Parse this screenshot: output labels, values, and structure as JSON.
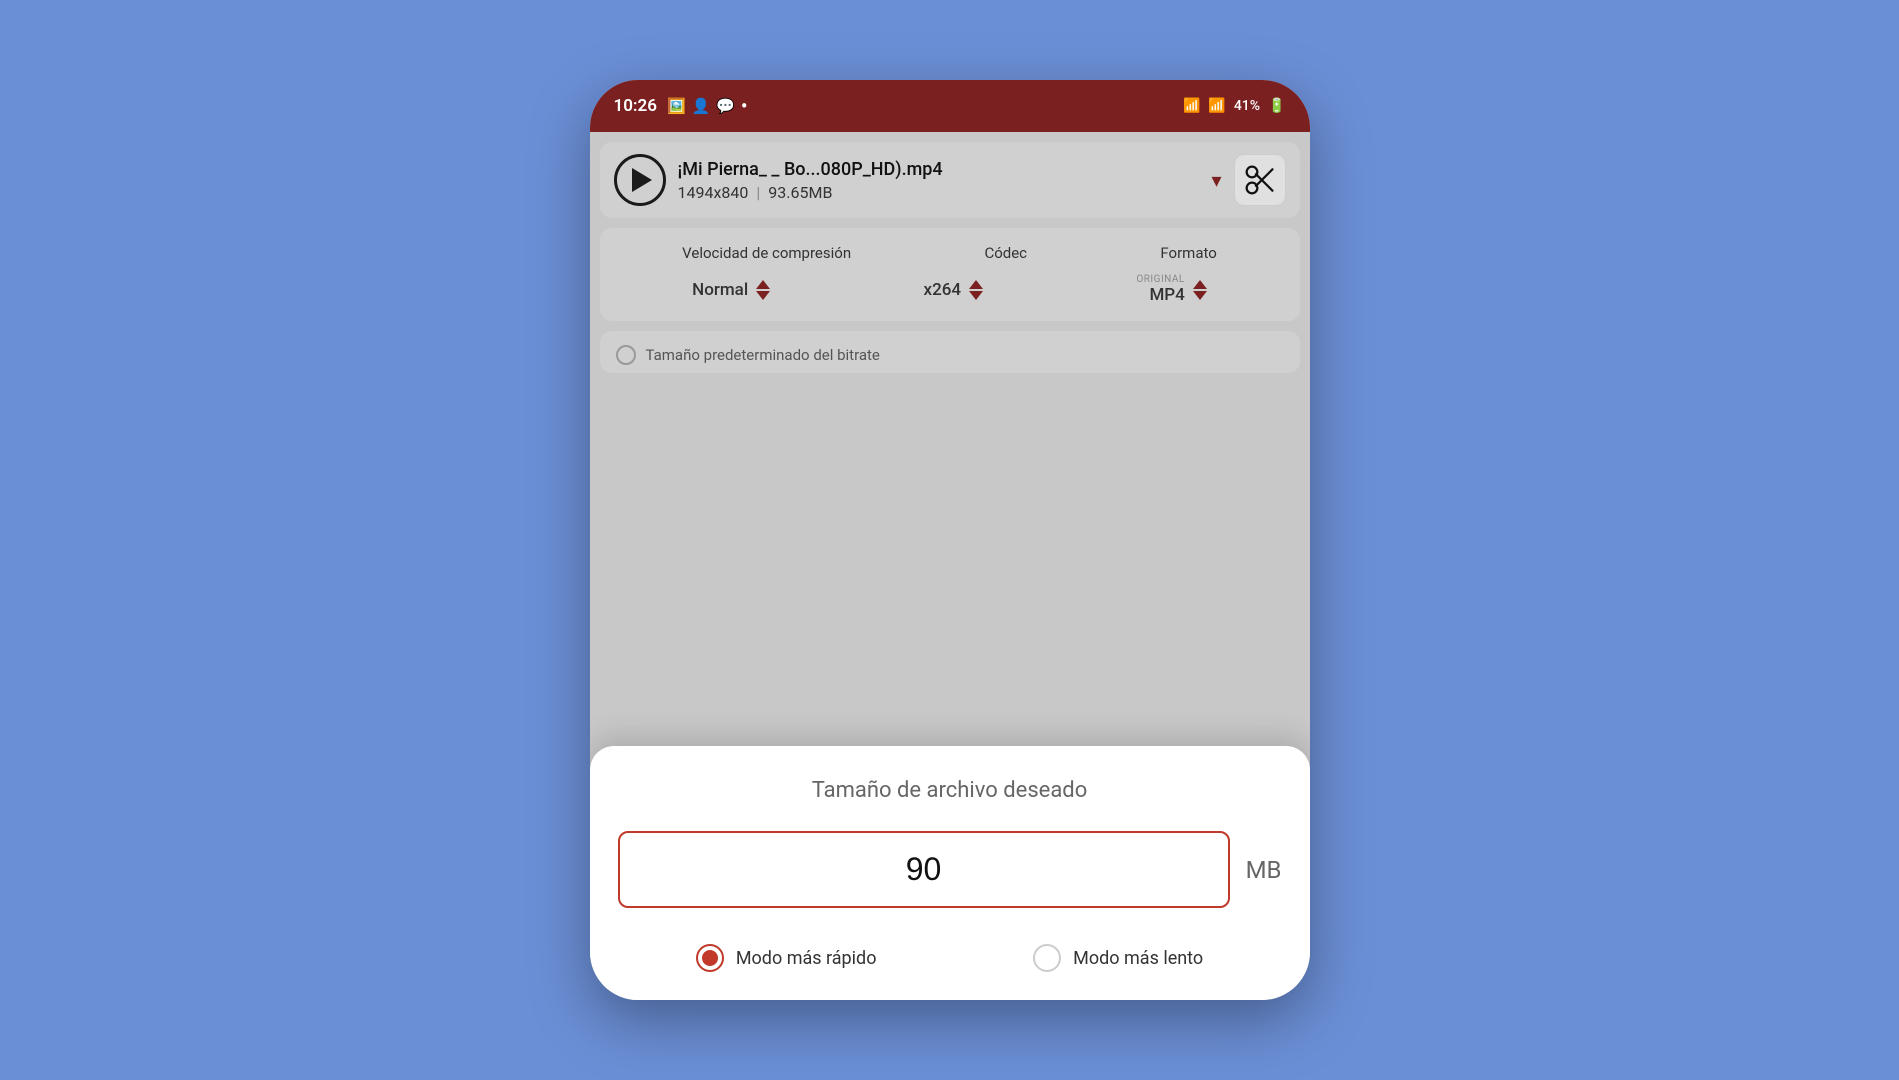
{
  "status_bar": {
    "time": "10:26",
    "battery": "41%",
    "battery_icon": "🔋",
    "signal_icon": "📶"
  },
  "file_selector": {
    "file_name": "¡Mi Pierna_ _ Bo...080P_HD).mp4",
    "resolution": "1494x840",
    "size": "93.65MB",
    "play_label": "play",
    "scissors_label": "scissors"
  },
  "settings": {
    "speed_label": "Velocidad de compresión",
    "codec_label": "Códec",
    "format_label": "Formato",
    "speed_value": "Normal",
    "codec_value": "x264",
    "format_value": "MP4",
    "format_badge": "ORIGINAL"
  },
  "dialog": {
    "title": "Tamaño de archivo deseado",
    "file_size_value": "90",
    "unit": "MB",
    "mode_fast_label": "Modo más rápido",
    "mode_slow_label": "Modo más lento",
    "mode_fast_selected": true,
    "mode_slow_selected": false
  }
}
